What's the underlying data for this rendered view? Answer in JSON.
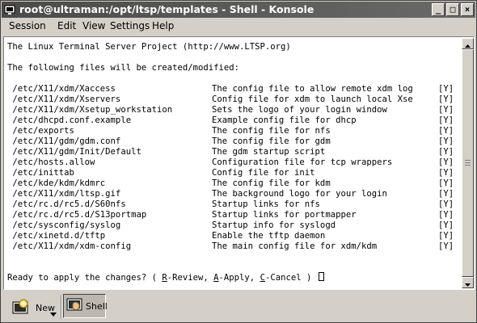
{
  "window": {
    "title": "root@ultraman:/opt/ltsp/templates - Shell - Konsole",
    "controls": {
      "minimize": "_",
      "maximize": "□",
      "close": "×"
    }
  },
  "menu": {
    "items": [
      "Session",
      "Edit",
      "View",
      "Settings",
      "Help"
    ]
  },
  "terminal": {
    "header": "The Linux Terminal Server Project (http://www.LTSP.org)",
    "intro": "The following files will be created/modified:",
    "files": [
      {
        "path": " /etc/X11/xdm/Xaccess",
        "desc": "The config file to allow remote xdm log",
        "flag": "[Y]"
      },
      {
        "path": " /etc/X11/xdm/Xservers",
        "desc": "Config file for xdm to launch local Xse",
        "flag": "[Y]"
      },
      {
        "path": " /etc/X11/xdm/Xsetup_workstation",
        "desc": "Sets the logo of your login window",
        "flag": "[Y]"
      },
      {
        "path": " /etc/dhcpd.conf.example",
        "desc": "Example config file for dhcp",
        "flag": "[Y]"
      },
      {
        "path": " /etc/exports",
        "desc": "The config file for nfs",
        "flag": "[Y]"
      },
      {
        "path": " /etc/X11/gdm/gdm.conf",
        "desc": "The config file for gdm",
        "flag": "[Y]"
      },
      {
        "path": " /etc/X11/gdm/Init/Default",
        "desc": "The gdm startup script",
        "flag": "[Y]"
      },
      {
        "path": " /etc/hosts.allow",
        "desc": "Configuration file for tcp wrappers",
        "flag": "[Y]"
      },
      {
        "path": " /etc/inittab",
        "desc": "Config file for init",
        "flag": "[Y]"
      },
      {
        "path": " /etc/kde/kdm/kdmrc",
        "desc": "The config file for kdm",
        "flag": "[Y]"
      },
      {
        "path": " /etc/X11/xdm/ltsp.gif",
        "desc": "The background logo for your login",
        "flag": "[Y]"
      },
      {
        "path": " /etc/rc.d/rc5.d/S60nfs",
        "desc": "Startup links for nfs",
        "flag": "[Y]"
      },
      {
        "path": " /etc/rc.d/rc5.d/S13portmap",
        "desc": "Startup links for portmapper",
        "flag": "[Y]"
      },
      {
        "path": " /etc/sysconfig/syslog",
        "desc": "Startup info for syslogd",
        "flag": "[Y]"
      },
      {
        "path": " /etc/xinetd.d/tftp",
        "desc": "Enable the tftp daemon",
        "flag": "[Y]"
      },
      {
        "path": " /etc/X11/xdm/xdm-config",
        "desc": "The main config file for xdm/kdm",
        "flag": "[Y]"
      }
    ],
    "prompt": {
      "question": "Ready to apply the changes? ( ",
      "opt1_key": "R",
      "opt1_rest": "-Review, ",
      "opt2_key": "A",
      "opt2_rest": "-Apply, ",
      "opt3_key": "C",
      "opt3_rest": "-Cancel ) "
    }
  },
  "tabbar": {
    "new_label": "New",
    "session_label": "Shell"
  },
  "colors": {
    "titlebar": "#4a4a4a",
    "chrome": "#d4d0c8",
    "terminal_bg": "#ffffff",
    "terminal_fg": "#000000"
  }
}
